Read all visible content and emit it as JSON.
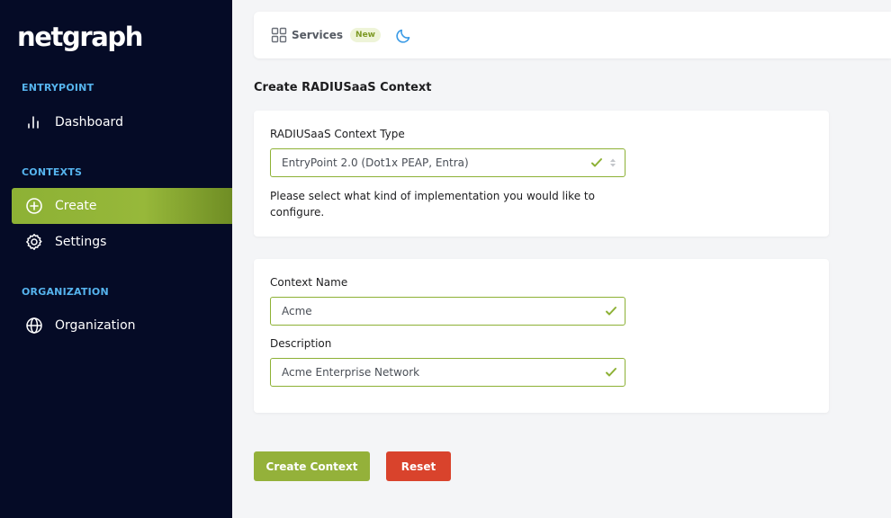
{
  "brand": {
    "logo_text": "netgraph"
  },
  "sidebar": {
    "sections": [
      {
        "label": "ENTRYPOINT"
      },
      {
        "label": "CONTEXTS"
      },
      {
        "label": "ORGANIZATION"
      }
    ],
    "items": [
      {
        "label": "Dashboard",
        "icon": "bar-chart-icon"
      },
      {
        "label": "Create",
        "icon": "plus-circle-icon",
        "active": true
      },
      {
        "label": "Settings",
        "icon": "gear-icon"
      },
      {
        "label": "Organization",
        "icon": "globe-icon"
      }
    ]
  },
  "topbar": {
    "services_label": "Services",
    "services_badge": "New",
    "services_icon": "grid-icon",
    "theme_icon": "moon-icon"
  },
  "page": {
    "title": "Create RADIUSaaS Context"
  },
  "form": {
    "context_type": {
      "label": "RADIUSaaS Context Type",
      "value": "EntryPoint 2.0 (Dot1x PEAP, Entra)",
      "help": "Please select what kind of implementation you would like to configure."
    },
    "context_name": {
      "label": "Context Name",
      "value": "Acme"
    },
    "description": {
      "label": "Description",
      "value": "Acme Enterprise Network"
    }
  },
  "actions": {
    "create_label": "Create Context",
    "reset_label": "Reset"
  },
  "colors": {
    "sidebar_bg": "#050b26",
    "accent_green": "#94b13a",
    "section_blue": "#56b4ee",
    "reset_red": "#d9432c"
  }
}
